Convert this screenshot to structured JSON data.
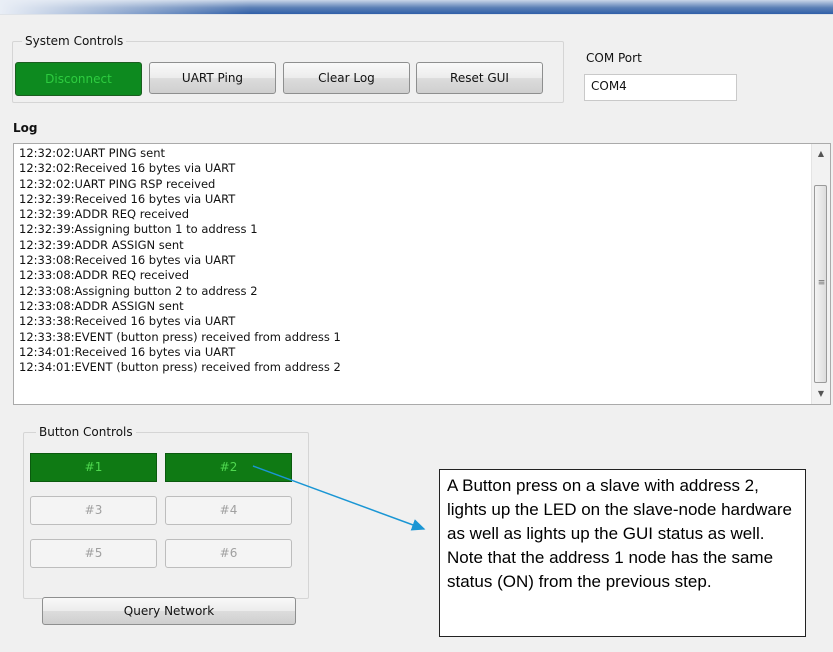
{
  "system_controls": {
    "label": "System Controls",
    "disconnect": "Disconnect",
    "uart_ping": "UART Ping",
    "clear_log": "Clear Log",
    "reset_gui": "Reset GUI"
  },
  "com_port": {
    "label": "COM Port",
    "value": "COM4"
  },
  "log": {
    "label": "Log",
    "lines": [
      "12:32:02:UART PING sent",
      "12:32:02:Received 16 bytes via UART",
      "12:32:02:UART PING RSP received",
      "12:32:39:Received 16 bytes via UART",
      "12:32:39:ADDR REQ received",
      "12:32:39:Assigning button 1 to address 1",
      "12:32:39:ADDR ASSIGN sent",
      "12:33:08:Received 16 bytes via UART",
      "12:33:08:ADDR REQ received",
      "12:33:08:Assigning button 2 to address 2",
      "12:33:08:ADDR ASSIGN sent",
      "12:33:38:Received 16 bytes via UART",
      "12:33:38:EVENT (button press) received from address 1",
      "12:34:01:Received 16 bytes via UART",
      "12:34:01:EVENT (button press) received from address 2"
    ],
    "scrollbar": {
      "up_icon": "▲",
      "down_icon": "▼",
      "grip_icon": "≡"
    }
  },
  "button_controls": {
    "label": "Button Controls",
    "buttons": [
      {
        "label": "#1",
        "state": "on"
      },
      {
        "label": "#2",
        "state": "on"
      },
      {
        "label": "#3",
        "state": "off"
      },
      {
        "label": "#4",
        "state": "off"
      },
      {
        "label": "#5",
        "state": "off"
      },
      {
        "label": "#6",
        "state": "off"
      }
    ],
    "query_network": "Query Network"
  },
  "annotation": {
    "text": "A Button press on a slave with address 2, lights up the LED on the slave-node hardware as well as lights up the GUI status as well. Note that the address 1 node has the same status (ON) from the previous step."
  },
  "colors": {
    "active_green": "#0f7a14",
    "arrow": "#1a96d4"
  }
}
